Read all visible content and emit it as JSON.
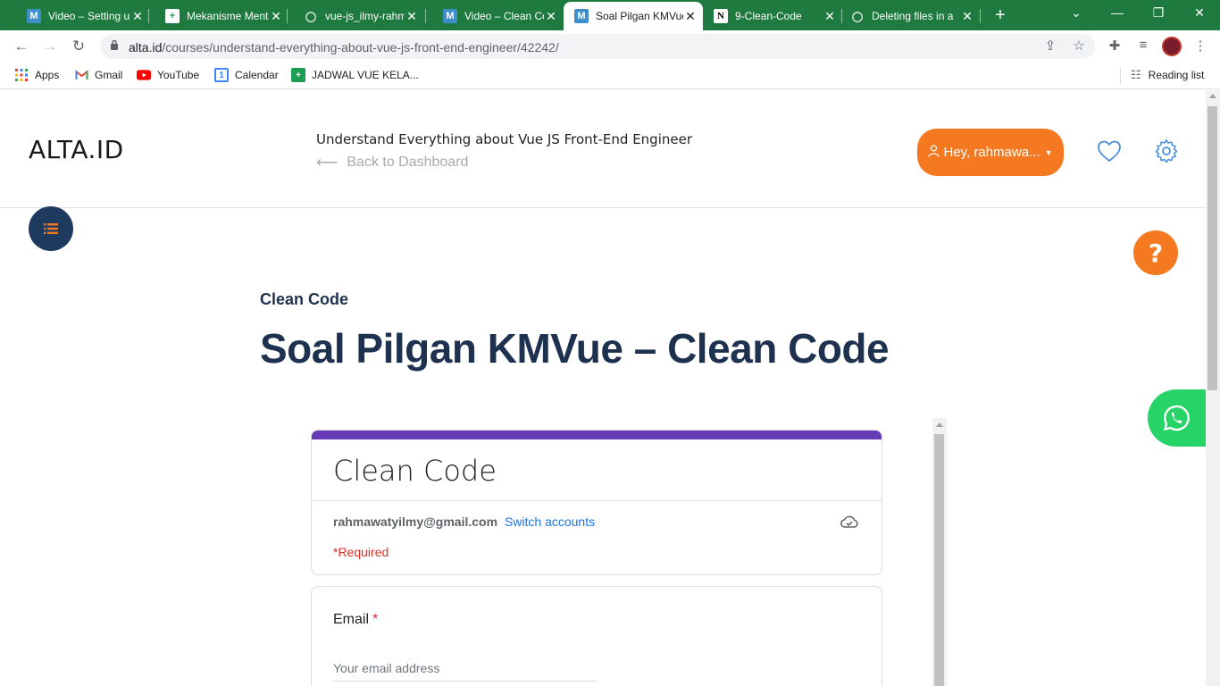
{
  "browser": {
    "tabs": [
      {
        "title": "Video – Setting up",
        "favicon": "M",
        "favicon_icon": "mekari-icon"
      },
      {
        "title": "Mekanisme Mentoring",
        "favicon": "+",
        "favicon_icon": "sheets-icon"
      },
      {
        "title": "vue-js_ilmy-rahmawaty",
        "favicon": "◯",
        "favicon_icon": "github-icon"
      },
      {
        "title": "Video – Clean Code",
        "favicon": "M",
        "favicon_icon": "mekari-icon"
      },
      {
        "title": "Soal Pilgan KMVue",
        "favicon": "M",
        "favicon_icon": "mekari-icon",
        "active": true
      },
      {
        "title": "9-Clean-Code",
        "favicon": "N",
        "favicon_icon": "notion-icon"
      },
      {
        "title": "Deleting files in a",
        "favicon": "◯",
        "favicon_icon": "github-icon"
      }
    ],
    "url_host": "alta.id",
    "url_path": "/courses/understand-everything-about-vue-js-front-end-engineer/42242/",
    "bookmarks": [
      {
        "label": "Apps",
        "icon": "apps-grid-icon"
      },
      {
        "label": "Gmail",
        "icon": "gmail-icon"
      },
      {
        "label": "YouTube",
        "icon": "youtube-icon"
      },
      {
        "label": "Calendar",
        "icon": "calendar-icon"
      },
      {
        "label": "JADWAL VUE KELA...",
        "icon": "sheets-icon"
      }
    ],
    "reading_list": "Reading list",
    "tab_bar_color": "#1f7a3f"
  },
  "site": {
    "logo": "ALTA.ID",
    "course_title": "Understand Everything about Vue JS Front-End Engineer",
    "back_link": "Back to Dashboard",
    "user_button": "Hey, rahmawa...",
    "accent": "#f47920",
    "navy": "#1e3250"
  },
  "lesson": {
    "section": "Clean Code",
    "title": "Soal Pilgan KMVue – Clean Code"
  },
  "form": {
    "title": "Clean Code",
    "account_email": "rahmawatyilmy@gmail.com",
    "switch_accounts": "Switch accounts",
    "required_note": "*Required",
    "question_label": "Email",
    "required_star": "*",
    "email_placeholder": "Your email address",
    "header_color": "#673ab7"
  }
}
